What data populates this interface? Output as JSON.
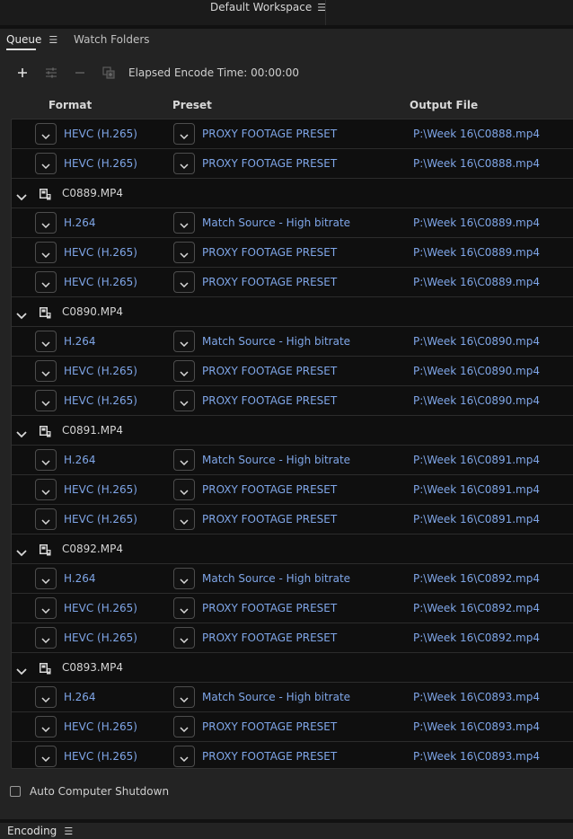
{
  "workspace": {
    "title": "Default Workspace",
    "menu_icon": "hamburger-menu-icon"
  },
  "tabs": [
    {
      "label": "Queue",
      "active": true
    },
    {
      "label": "Watch Folders",
      "active": false
    }
  ],
  "toolbar": {
    "add_icon": "plus-icon",
    "settings_icon": "sliders-icon",
    "remove_icon": "minus-icon",
    "duplicate_icon": "duplicate-icon",
    "elapsed_label": "Elapsed Encode Time:",
    "elapsed_value": "00:00:00"
  },
  "columns": {
    "format": "Format",
    "preset": "Preset",
    "output": "Output File"
  },
  "colors": {
    "link": "#7fa6e8",
    "background": "#232323",
    "list_background": "#0f0f0f"
  },
  "rows": [
    {
      "kind": "item",
      "format": "HEVC (H.265)",
      "preset": "PROXY FOOTAGE PRESET",
      "output": "P:\\Week 16\\C0888.mp4"
    },
    {
      "kind": "item",
      "format": "HEVC (H.265)",
      "preset": "PROXY FOOTAGE PRESET",
      "output": "P:\\Week 16\\C0888.mp4"
    },
    {
      "kind": "group",
      "name": "C0889.MP4"
    },
    {
      "kind": "item",
      "format": "H.264",
      "preset": "Match Source - High bitrate",
      "output": "P:\\Week 16\\C0889.mp4"
    },
    {
      "kind": "item",
      "format": "HEVC (H.265)",
      "preset": "PROXY FOOTAGE PRESET",
      "output": "P:\\Week 16\\C0889.mp4"
    },
    {
      "kind": "item",
      "format": "HEVC (H.265)",
      "preset": "PROXY FOOTAGE PRESET",
      "output": "P:\\Week 16\\C0889.mp4"
    },
    {
      "kind": "group",
      "name": "C0890.MP4"
    },
    {
      "kind": "item",
      "format": "H.264",
      "preset": "Match Source - High bitrate",
      "output": "P:\\Week 16\\C0890.mp4"
    },
    {
      "kind": "item",
      "format": "HEVC (H.265)",
      "preset": "PROXY FOOTAGE PRESET",
      "output": "P:\\Week 16\\C0890.mp4"
    },
    {
      "kind": "item",
      "format": "HEVC (H.265)",
      "preset": "PROXY FOOTAGE PRESET",
      "output": "P:\\Week 16\\C0890.mp4"
    },
    {
      "kind": "group",
      "name": "C0891.MP4"
    },
    {
      "kind": "item",
      "format": "H.264",
      "preset": "Match Source - High bitrate",
      "output": "P:\\Week 16\\C0891.mp4"
    },
    {
      "kind": "item",
      "format": "HEVC (H.265)",
      "preset": "PROXY FOOTAGE PRESET",
      "output": "P:\\Week 16\\C0891.mp4"
    },
    {
      "kind": "item",
      "format": "HEVC (H.265)",
      "preset": "PROXY FOOTAGE PRESET",
      "output": "P:\\Week 16\\C0891.mp4"
    },
    {
      "kind": "group",
      "name": "C0892.MP4"
    },
    {
      "kind": "item",
      "format": "H.264",
      "preset": "Match Source - High bitrate",
      "output": "P:\\Week 16\\C0892.mp4"
    },
    {
      "kind": "item",
      "format": "HEVC (H.265)",
      "preset": "PROXY FOOTAGE PRESET",
      "output": "P:\\Week 16\\C0892.mp4"
    },
    {
      "kind": "item",
      "format": "HEVC (H.265)",
      "preset": "PROXY FOOTAGE PRESET",
      "output": "P:\\Week 16\\C0892.mp4"
    },
    {
      "kind": "group",
      "name": "C0893.MP4"
    },
    {
      "kind": "item",
      "format": "H.264",
      "preset": "Match Source - High bitrate",
      "output": "P:\\Week 16\\C0893.mp4"
    },
    {
      "kind": "item",
      "format": "HEVC (H.265)",
      "preset": "PROXY FOOTAGE PRESET",
      "output": "P:\\Week 16\\C0893.mp4"
    },
    {
      "kind": "item",
      "format": "HEVC (H.265)",
      "preset": "PROXY FOOTAGE PRESET",
      "output": "P:\\Week 16\\C0893.mp4"
    }
  ],
  "footer": {
    "shutdown_label": "Auto Computer Shutdown",
    "shutdown_checked": false
  },
  "encoding_panel": {
    "label": "Encoding"
  }
}
